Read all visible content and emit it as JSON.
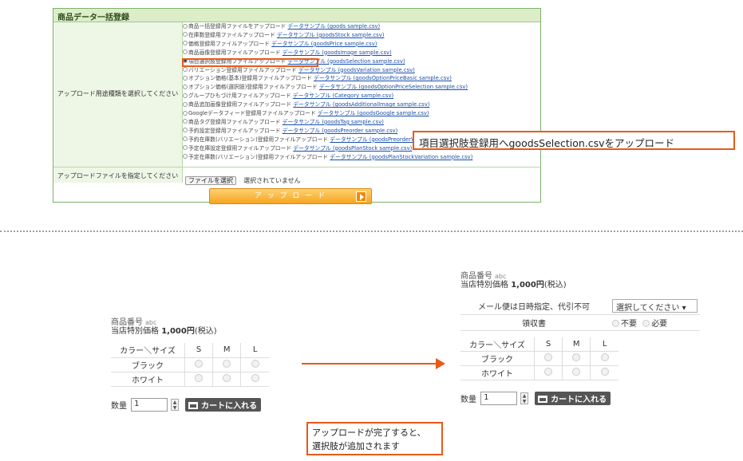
{
  "panel": {
    "title": "商品データ一括登録",
    "upload_type_label": "アップロード用途種類を選択してください",
    "file_label": "アップロードファイルを指定してください",
    "file_button": "ファイルを選択",
    "no_file_text": "選択されていません",
    "upload_button": "ア ッ プ ロ ー ド",
    "options": [
      {
        "label": "商品一括登録用ファイルをアップロード",
        "link": "データサンプル (goods sample.csv)",
        "selected": false
      },
      {
        "label": "在庫数登録用ファイルアップロード",
        "link": "データサンプル (goodsStock sample.csv)",
        "selected": false
      },
      {
        "label": "価格登録用ファイルアップロード",
        "link": "データサンプル (goodsPrice sample.csv)",
        "selected": false
      },
      {
        "label": "商品画像登録用ファイルアップロード",
        "link": "データサンプル (goodsImage sample.csv)",
        "selected": false
      },
      {
        "label": "項目選択肢登録用ファイルアップロード",
        "link": "データサンプル (goodsSelection sample.csv)",
        "selected": true
      },
      {
        "label": "バリエーション登録用ファイルアップロード",
        "link": "データサンプル (goodsVariation sample.csv)",
        "selected": false
      },
      {
        "label": "オプション価格(基本)登録用ファイルアップロード",
        "link": "データサンプル (goodsOptionPriceBasic sample.csv)",
        "selected": false
      },
      {
        "label": "オプション価格(選択肢)登録用ファイルアップロード",
        "link": "データサンプル (goodsOptionPriceSelection sample.csv)",
        "selected": false
      },
      {
        "label": "グループひもづけ用ファイルアップロード",
        "link": "データサンプル (Category sample.csv)",
        "selected": false
      },
      {
        "label": "商品追加画像登録用ファイルアップロード",
        "link": "データサンプル (goodsAdditionalImage sample.csv)",
        "selected": false
      },
      {
        "label": "Googleデータフィード登録用ファイルアップロード",
        "link": "データサンプル (goodsGoogle sample.csv)",
        "selected": false
      },
      {
        "label": "商品タグ登録用ファイルアップロード",
        "link": "データサンプル (goodsTag sample.csv)",
        "selected": false
      },
      {
        "label": "予約設定登録用ファイルアップロード",
        "link": "データサンプル (goodsPreorder sample.csv)",
        "selected": false
      },
      {
        "label": "予約在庫数(バリエーション)登録用ファイルアップロード",
        "link": "データサンプル (goodsPreorderVariation sample.csv)",
        "selected": false
      },
      {
        "label": "予定在庫設定登録用ファイルアップロード",
        "link": "データサンプル (goodsPlanStock sample.csv)",
        "selected": false
      },
      {
        "label": "予定在庫数(バリエーション)登録用ファイルアップロード",
        "link": "データサンプル (goodsPlanStockVariation sample.csv)",
        "selected": false
      }
    ]
  },
  "callout": "項目選択肢登録用へgoodsSelection.csvをアップロード",
  "before": {
    "code_label": "商品番号",
    "code_value": "abc",
    "price_prefix": "当店特別価格",
    "price_value": "1,000円",
    "price_suffix": "(税込)",
    "variant_header": [
      "カラー＼サイズ",
      "S",
      "M",
      "L"
    ],
    "variant_rows": [
      "ブラック",
      "ホワイト"
    ],
    "qty_label": "数量",
    "qty_value": "1",
    "cart_button": "カートに入れる"
  },
  "after": {
    "code_label": "商品番号",
    "code_value": "abc",
    "price_prefix": "当店特別価格",
    "price_value": "1,000円",
    "price_suffix": "(税込)",
    "mail_label": "メール便は日時指定、代引不可",
    "mail_select": "選択してください ▾",
    "receipt_label": "領収書",
    "receipt_opt1": "不要",
    "receipt_opt2": "必要",
    "variant_header": [
      "カラー＼サイズ",
      "S",
      "M",
      "L"
    ],
    "variant_rows": [
      "ブラック",
      "ホワイト"
    ],
    "qty_label": "数量",
    "qty_value": "1",
    "cart_button": "カートに入れる"
  },
  "note": {
    "line1": "アップロードが完了すると、",
    "line2": "選択肢が追加されます"
  },
  "colors": {
    "accent": "#e85a1a",
    "panel_border": "#7fb36d",
    "panel_header": "#dcedc8",
    "upload_button": "#f5a521",
    "link": "#1b4fa8"
  }
}
